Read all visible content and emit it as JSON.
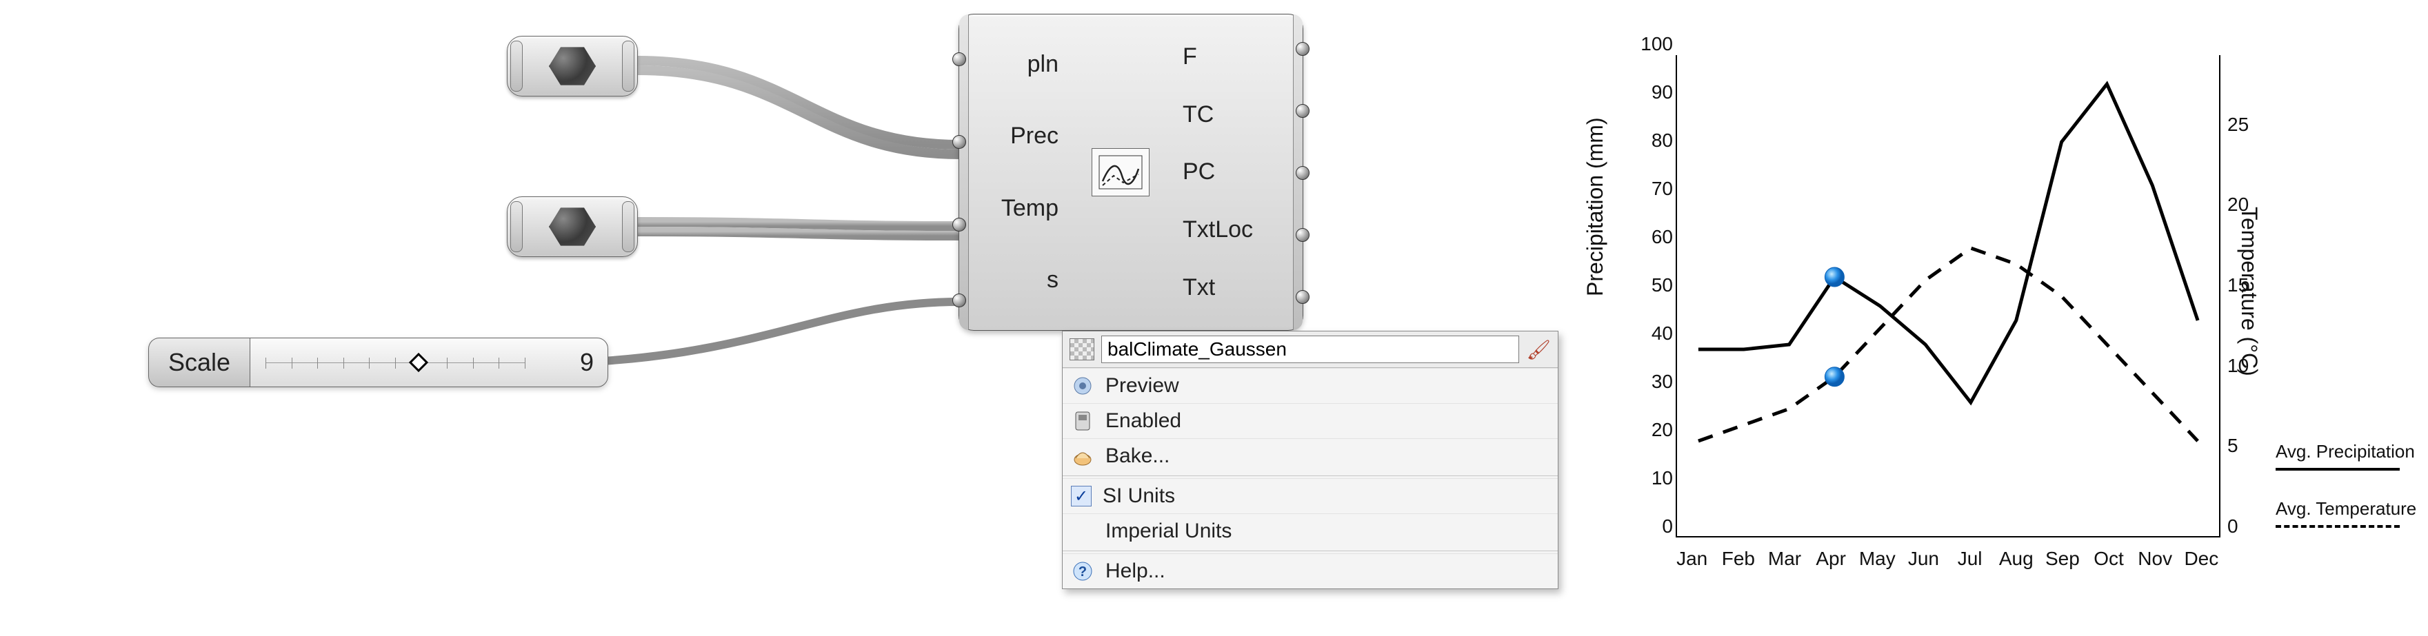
{
  "slider": {
    "label": "Scale",
    "value": "9"
  },
  "component": {
    "inputs": [
      "pln",
      "Prec",
      "Temp",
      "s"
    ],
    "outputs": [
      "F",
      "TC",
      "PC",
      "TxtLoc",
      "Txt"
    ]
  },
  "context_menu": {
    "name_field": "balClimate_Gaussen",
    "items": [
      {
        "key": "preview",
        "label": "Preview",
        "icon": "preview"
      },
      {
        "key": "enabled",
        "label": "Enabled",
        "icon": "enabled"
      },
      {
        "key": "bake",
        "label": "Bake...",
        "icon": "bake"
      },
      {
        "key": "si",
        "label": "SI Units",
        "checked": true
      },
      {
        "key": "imperial",
        "label": "Imperial Units",
        "checked": false
      },
      {
        "key": "help",
        "label": "Help...",
        "icon": "help"
      }
    ]
  },
  "chart_data": {
    "type": "line",
    "x_categories": [
      "Jan",
      "Feb",
      "Mar",
      "Apr",
      "May",
      "Jun",
      "Jul",
      "Aug",
      "Sep",
      "Oct",
      "Nov",
      "Dec"
    ],
    "y_left": {
      "label": "Precipitation (mm)",
      "ticks": [
        0,
        10,
        20,
        30,
        40,
        50,
        60,
        70,
        80,
        90,
        100
      ],
      "lim": [
        0,
        100
      ]
    },
    "y_right": {
      "label": "Temperature (°C)",
      "ticks": [
        0,
        5,
        10,
        15,
        20,
        25
      ],
      "lim": [
        0,
        30
      ]
    },
    "series": [
      {
        "name": "Avg. Precipitation",
        "axis": "left",
        "style": "solid",
        "values": [
          39,
          39,
          40,
          54,
          48,
          40,
          28,
          45,
          82,
          94,
          73,
          45
        ],
        "highlight_index": 3
      },
      {
        "name": "Avg. Temperature",
        "axis": "right",
        "style": "dashed",
        "values": [
          6,
          7,
          8,
          10,
          13,
          16,
          18,
          17,
          15,
          12,
          9,
          6
        ],
        "highlight_index": 3
      }
    ],
    "legend": [
      {
        "label": "Avg. Precipitation",
        "style": "solid"
      },
      {
        "label": "Avg. Temperature",
        "style": "dashed"
      }
    ]
  }
}
